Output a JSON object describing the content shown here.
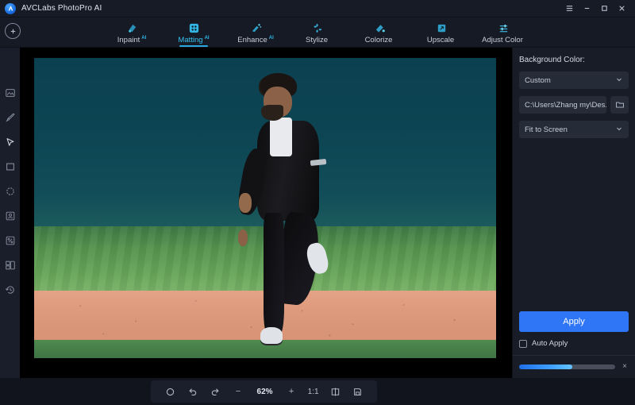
{
  "window": {
    "title": "AVCLabs PhotoPro AI",
    "controls": [
      {
        "name": "menu",
        "glyph": "menu-icon"
      },
      {
        "name": "minimize",
        "glyph": "minimize-icon"
      },
      {
        "name": "maximize",
        "glyph": "maximize-icon"
      },
      {
        "name": "close",
        "glyph": "close-icon"
      }
    ]
  },
  "tabbar": {
    "add_label": "+",
    "tabs": [
      {
        "label": "Inpaint",
        "badge": "AI",
        "icon": "inpaint-icon",
        "active": false
      },
      {
        "label": "Matting",
        "badge": "AI",
        "icon": "matting-icon",
        "active": true
      },
      {
        "label": "Enhance",
        "badge": "AI",
        "icon": "enhance-icon",
        "active": false
      },
      {
        "label": "Stylize",
        "badge": "",
        "icon": "stylize-icon",
        "active": false
      },
      {
        "label": "Colorize",
        "badge": "",
        "icon": "colorize-icon",
        "active": false
      },
      {
        "label": "Upscale",
        "badge": "",
        "icon": "upscale-icon",
        "active": false
      },
      {
        "label": "Adjust Color",
        "badge": "",
        "icon": "adjust-color-icon",
        "active": false
      }
    ]
  },
  "left_tools": [
    {
      "name": "image-tool",
      "icon": "image-icon",
      "selected": false
    },
    {
      "name": "brush-tool",
      "icon": "brush-icon",
      "selected": false
    },
    {
      "name": "select-tool",
      "icon": "cursor-icon",
      "selected": true
    },
    {
      "name": "rectangle-tool",
      "icon": "rectangle-icon",
      "selected": false
    },
    {
      "name": "ellipse-tool",
      "icon": "circle-icon",
      "selected": false
    },
    {
      "name": "portrait-tool",
      "icon": "portrait-icon",
      "selected": false
    },
    {
      "name": "magic-wand-tool",
      "icon": "magic-wand-icon",
      "selected": false
    },
    {
      "name": "layers-tool",
      "icon": "layers-icon",
      "selected": false
    },
    {
      "name": "history-tool",
      "icon": "history-icon",
      "selected": false
    }
  ],
  "panel": {
    "section_label": "Background Color:",
    "background_color_value": "Custom",
    "path_value": "C:\\Users\\Zhang my\\Des...",
    "folder_button": "folder-icon",
    "fit_value": "Fit to Screen",
    "apply_label": "Apply",
    "auto_apply_label": "Auto Apply",
    "auto_apply_checked": false,
    "progress_percent": 55,
    "progress_close": "×"
  },
  "bottombar": {
    "reset_icon": "reset-icon",
    "undo_icon": "undo-icon",
    "redo_icon": "redo-icon",
    "zoom_out_label": "−",
    "zoom_value": "62%",
    "zoom_in_label": "+",
    "actual_size_label": "1:1",
    "compare_icon": "compare-icon",
    "save_icon": "save-icon"
  },
  "photo": {
    "description": "Man jogging on a baseball field with teal backdrop",
    "colors": {
      "backdrop": "#0d4352",
      "grass": "#5a9a52",
      "dirt": "#dd9a7c",
      "jacket": "#121216",
      "shoes": "#e1e5ea"
    }
  },
  "theme": {
    "accent": "#2f76f6",
    "tab_active": "#35c3f0",
    "panel_bg": "#181c27",
    "chrome_bg": "#161a25"
  }
}
